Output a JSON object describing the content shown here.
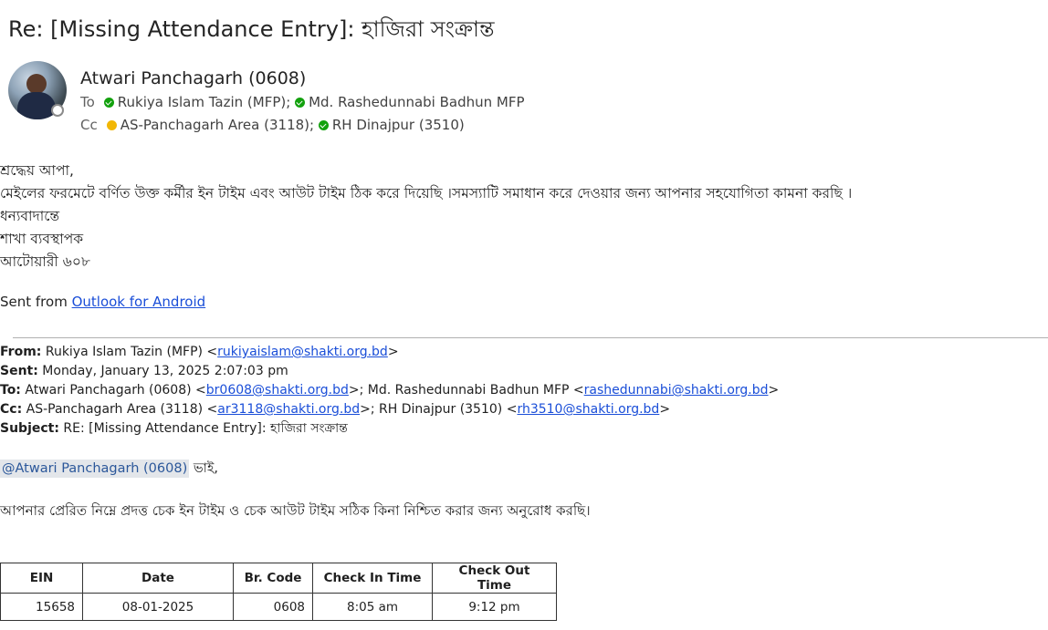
{
  "email": {
    "subject": "Re: [Missing Attendance Entry]: হাজিরা সংক্রান্ত",
    "sender": "Atwari Panchagarh (0608)",
    "to_label": "To",
    "cc_label": "Cc",
    "to": [
      "Rukiya Islam Tazin (MFP);",
      "Md. Rashedunnabi Badhun MFP"
    ],
    "cc": [
      "AS-Panchagarh Area (3118);",
      "RH Dinajpur (3510)"
    ]
  },
  "body": {
    "lines": [
      "শ্রদ্ধেয় আপা,",
      "মেইলের ফরমেটে বর্ণিত উক্ত কর্মীর ইন টাইম এবং আউট টাইম ঠিক করে দিয়েছি ।সমস্যাটি সমাধান করে দেওয়ার জন্য আপনার সহযোগিতা কামনা করছি ।",
      "ধন্যবাদান্তে",
      "শাখা ব্যবস্থাপক",
      "আটোয়ারী ৬০৮"
    ],
    "sent_from_prefix": "Sent from ",
    "sent_from_link": "Outlook for Android"
  },
  "quoted": {
    "from_label": "From:",
    "from_name": " Rukiya Islam Tazin (MFP) <",
    "from_email": "rukiyaislam@shakti.org.bd",
    "sent_label": "Sent:",
    "sent_value": " Monday, January 13, 2025 2:07:03 pm",
    "to_label": "To:",
    "to_name1": " Atwari Panchagarh (0608) <",
    "to_email1": "br0608@shakti.org.bd",
    "to_name2": ">; Md. Rashedunnabi Badhun MFP <",
    "to_email2": "rashedunnabi@shakti.org.bd",
    "cc_label": "Cc:",
    "cc_name1": " AS-Panchagarh Area (3118) <",
    "cc_email1": "ar3118@shakti.org.bd",
    "cc_name2": ">; RH Dinajpur (3510) <",
    "cc_email2": "rh3510@shakti.org.bd",
    "subject_label": "Subject:",
    "subject_value": " RE: [Missing Attendance Entry]: হাজিরা সংক্রান্ত",
    "mention": "@Atwari Panchagarh (0608)",
    "mention_suffix": " ভাই,",
    "request": "আপনার প্রেরিত নিম্নে প্রদত্ত চেক ইন টাইম ও চেক আউট টাইম সঠিক কিনা নিশ্চিত করার জন্য অনুরোধ করছি।"
  },
  "table": {
    "headers": [
      "EIN",
      "Date",
      "Br. Code",
      "Check In Time",
      "Check Out Time"
    ],
    "rows": [
      [
        "15658",
        "08-01-2025",
        "0608",
        "8:05 am",
        "9:12 pm"
      ]
    ]
  },
  "colors": {
    "presence_available": "#13a10e",
    "presence_away": "#f2b705",
    "link": "#1a4ed8"
  }
}
